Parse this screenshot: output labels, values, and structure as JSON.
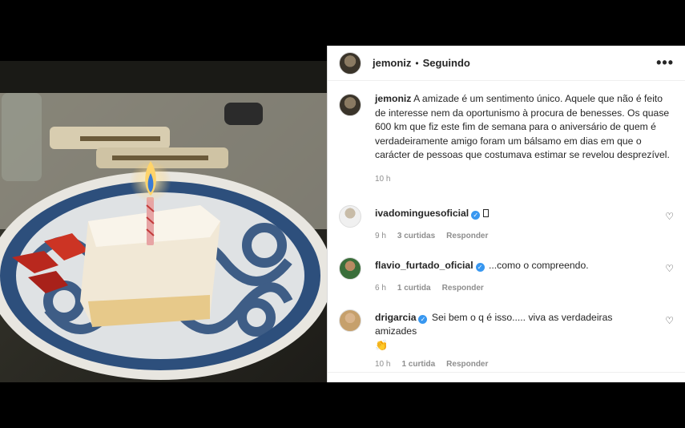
{
  "post": {
    "username": "jemoniz",
    "separator": "•",
    "follow_status": "Seguindo",
    "more_icon": "more-options-icon",
    "caption": "A amizade é um sentimento único. Aquele que não é feito de interesse nem da oportunismo à procura de benesses. Os quase 600 km que fiz este fim de semana para o aniversário de quem é verdadeiramente amigo foram um bálsamo em dias em que o carácter de pessoas que costumava estimar se revelou desprezível.",
    "time": "10 h"
  },
  "comments": [
    {
      "username": "ivadominguesoficial",
      "text": "",
      "time": "9 h",
      "likes": "3 curtidas",
      "reply": "Responder"
    },
    {
      "username": "flavio_furtado_oficial",
      "text": "...como o compreendo.",
      "time": "6 h",
      "likes": "1 curtida",
      "reply": "Responder"
    },
    {
      "username": "drigarcia",
      "text": "Sei bem o q é isso..... viva as verdadeiras amizades",
      "emoji": "👏",
      "time": "10 h",
      "likes": "1 curtida",
      "reply": "Responder"
    }
  ],
  "colors": {
    "verified": "#3897f0",
    "text": "#262626",
    "muted": "#8e8e8e"
  }
}
